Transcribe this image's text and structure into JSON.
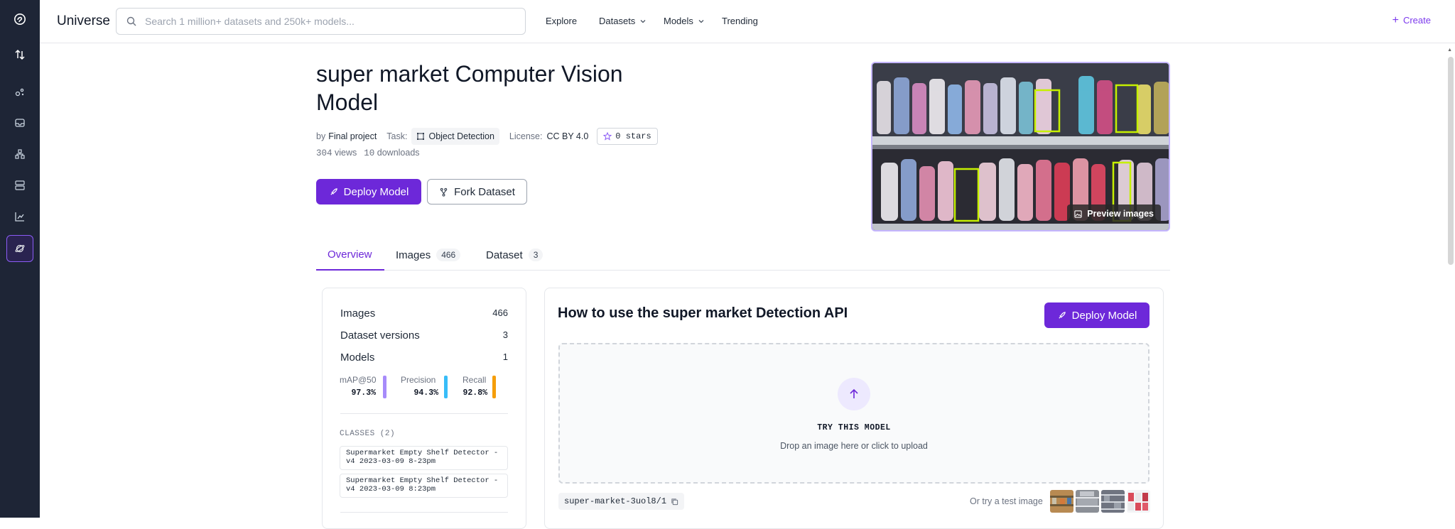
{
  "rail": {
    "items": [
      {
        "icon": "logo-icon"
      },
      {
        "icon": "upload-download-icon"
      },
      {
        "icon": "sparkles-icon"
      },
      {
        "icon": "inbox-icon"
      },
      {
        "icon": "workflow-icon"
      },
      {
        "icon": "server-icon"
      },
      {
        "icon": "analytics-icon"
      },
      {
        "icon": "universe-icon",
        "active": true
      }
    ]
  },
  "topbar": {
    "brand": "Universe",
    "search_placeholder": "Search 1 million+ datasets and 250k+ models...",
    "nav": {
      "explore": "Explore",
      "datasets": "Datasets",
      "models": "Models",
      "trending": "Trending"
    },
    "create": "Create"
  },
  "header": {
    "title": "super market Computer Vision Model",
    "by_label": "by",
    "author": "Final project",
    "task_label": "Task:",
    "task": "Object Detection",
    "license_label": "License:",
    "license": "CC BY 4.0",
    "stars": "0 stars",
    "views_count": "304",
    "views_label": "views",
    "downloads_count": "10",
    "downloads_label": "downloads",
    "deploy_label": "Deploy Model",
    "fork_label": "Fork Dataset",
    "preview_label": "Preview images"
  },
  "tabs": [
    {
      "label": "Overview",
      "count": null,
      "active": true
    },
    {
      "label": "Images",
      "count": "466"
    },
    {
      "label": "Dataset",
      "count": "3"
    }
  ],
  "summary": {
    "images_label": "Images",
    "images_value": "466",
    "versions_label": "Dataset versions",
    "versions_value": "3",
    "models_label": "Models",
    "models_value": "1",
    "metrics": [
      {
        "label": "mAP@50",
        "value": "97.3%",
        "color": "#a78bfa"
      },
      {
        "label": "Precision",
        "value": "94.3%",
        "color": "#38bdf8"
      },
      {
        "label": "Recall",
        "value": "92.8%",
        "color": "#f59e0b"
      }
    ],
    "classes_heading": "CLASSES (2)",
    "classes": [
      "Supermarket Empty Shelf Detector - v4 2023-03-09 8-23pm",
      "Supermarket Empty Shelf Detector - v4 2023-03-09 8:23pm"
    ]
  },
  "api": {
    "heading": "How to use the super market Detection API",
    "deploy_label": "Deploy Model",
    "drop_title": "TRY THIS MODEL",
    "drop_subtitle": "Drop an image here or click to upload",
    "model_id": "super-market-3uol8/1",
    "try_test": "Or try a test image"
  },
  "colors": {
    "accent": "#6d28d9",
    "rail_bg": "#1e2536",
    "bbox": "#c6f000"
  }
}
